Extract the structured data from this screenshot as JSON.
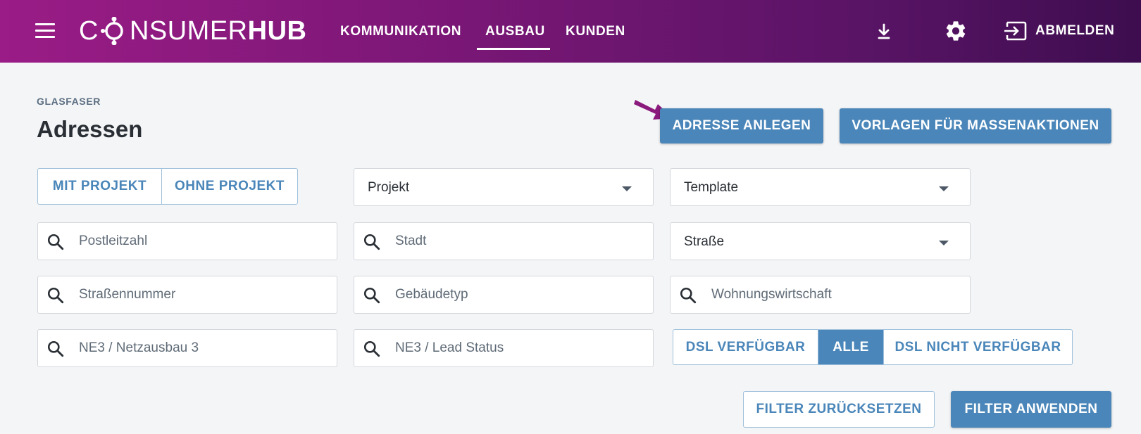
{
  "header": {
    "logo_left": "C",
    "logo_mid": "NSUMER",
    "logo_bold": "HUB",
    "nav": [
      {
        "label": "KOMMUNIKATION"
      },
      {
        "label": "AUSBAU",
        "active": true
      },
      {
        "label": "KUNDEN"
      }
    ],
    "logout_label": "ABMELDEN",
    "icons": [
      "menu-icon",
      "download-icon",
      "gear-icon",
      "logout-icon"
    ]
  },
  "page": {
    "breadcrumb": "GLASFASER",
    "title": "Adressen",
    "actions": {
      "add_address": "ADRESSE ANLEGEN",
      "templates": "VORLAGEN FÜR MASSENAKTIONEN"
    }
  },
  "filters": {
    "project_toggle": {
      "with": "MIT PROJEKT",
      "without": "OHNE PROJEKT"
    },
    "project_select": "Projekt",
    "template_select": "Template",
    "street_select": "Straße",
    "postcode_placeholder": "Postleitzahl",
    "city_placeholder": "Stadt",
    "street_number_placeholder": "Straßennummer",
    "building_type_placeholder": "Gebäudetyp",
    "housing_company_placeholder": "Wohnungswirtschaft",
    "ne3_network_placeholder": "NE3 / Netzausbau 3",
    "ne3_lead_placeholder": "NE3 / Lead Status",
    "dsl_toggle": {
      "available": "DSL VERFÜGBAR",
      "all": "ALLE",
      "not_available": "DSL NICHT VERFÜGBAR",
      "selected": "ALLE"
    },
    "reset_label": "FILTER ZURÜCKSETZEN",
    "apply_label": "FILTER ANWENDEN"
  },
  "colors": {
    "header_start": "#9a1c86",
    "header_end": "#3d0d4f",
    "primary": "#4a86b9",
    "arrow": "#8a1a7c"
  }
}
